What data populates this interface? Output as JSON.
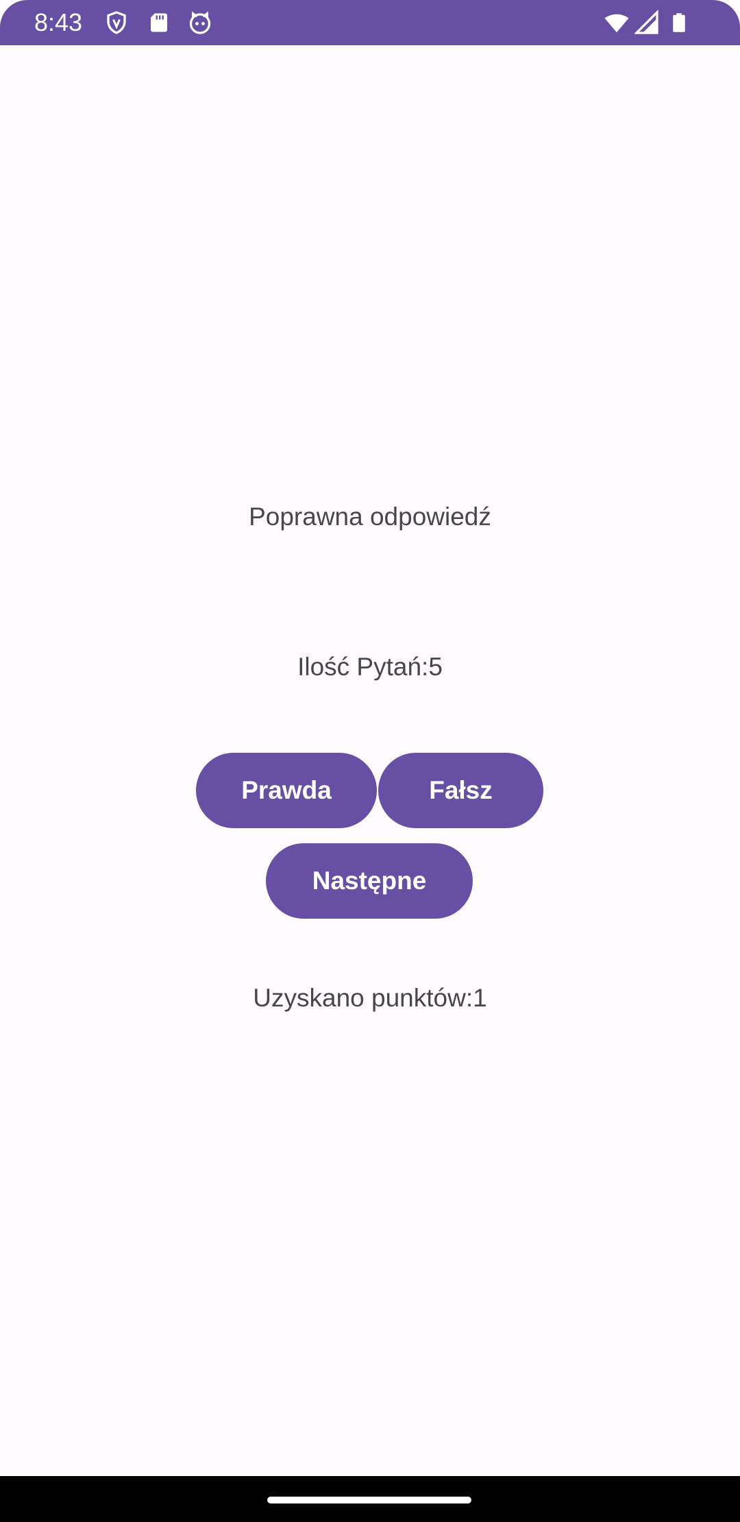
{
  "status_bar": {
    "time": "8:43",
    "icons_left": [
      "shield-icon",
      "sd-card-icon",
      "cat-icon"
    ],
    "icons_right": [
      "wifi-icon",
      "signal-icon",
      "battery-icon"
    ],
    "color": "#6750a4"
  },
  "quiz": {
    "question": "Poprawna odpowiedź",
    "question_count": "Ilość Pytań:5",
    "true_button": "Prawda",
    "false_button": "Fałsz",
    "next_button": "Następne",
    "score": "Uzyskano punktów:1"
  },
  "colors": {
    "accent": "#6750a4",
    "background": "#fffbfe",
    "text": "#49454f"
  }
}
